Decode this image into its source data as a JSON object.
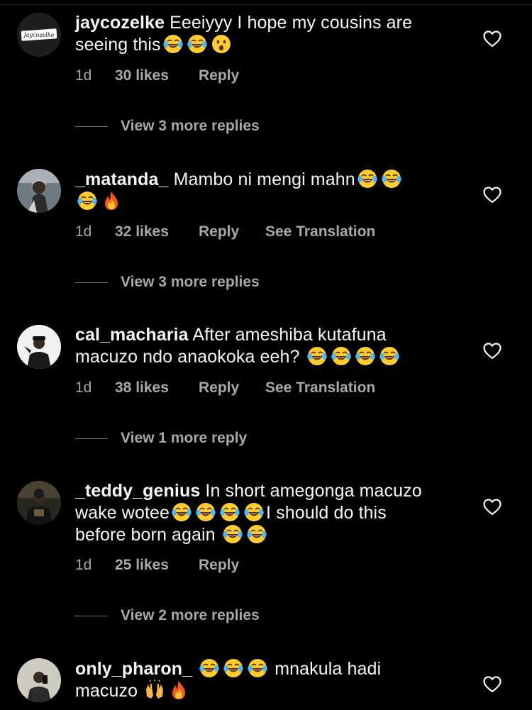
{
  "comments": [
    {
      "username": "jaycozelke",
      "avatar_text": "Jaycozelke",
      "text_line1": "Eeeiyyy I hope my cousins are",
      "text_line2": "seeing this",
      "emojis_line2": [
        "joy-emoji",
        "joy-emoji",
        "astonished-emoji"
      ],
      "time": "1d",
      "likes": "30 likes",
      "reply": "Reply",
      "view_more": "View 3 more replies"
    },
    {
      "username": "_matanda_",
      "text_line1": "Mambo ni mengi mahn",
      "emojis_line1": [
        "joy-emoji",
        "joy-emoji"
      ],
      "emojis_line2": [
        "joy-emoji",
        "fire-emoji"
      ],
      "time": "1d",
      "likes": "32 likes",
      "reply": "Reply",
      "translate": "See Translation",
      "view_more": "View 3 more replies"
    },
    {
      "username": "cal_macharia",
      "text_line1": "After ameshiba kutafuna",
      "text_line2": "macuzo ndo anaokoka eeh?",
      "emojis_line2": [
        "joy-emoji",
        "joy-emoji",
        "joy-emoji",
        "joy-emoji"
      ],
      "time": "1d",
      "likes": "38 likes",
      "reply": "Reply",
      "translate": "See Translation",
      "view_more": "View 1 more reply"
    },
    {
      "username": "_teddy_genius",
      "text_line1": "In short amegonga macuzo",
      "text_line2a": "wake wotee",
      "emojis_line2": [
        "joy-emoji",
        "joy-emoji",
        "joy-emoji",
        "joy-emoji"
      ],
      "text_line2b": "I should do this",
      "text_line3": "before born again",
      "emojis_line3": [
        "joy-emoji",
        "joy-emoji"
      ],
      "time": "1d",
      "likes": "25 likes",
      "reply": "Reply",
      "view_more": "View 2 more replies"
    },
    {
      "username": "only_pharon_",
      "emojis_line1": [
        "joy-emoji",
        "joy-emoji",
        "joy-emoji"
      ],
      "text_line1": "mnakula hadi",
      "text_line2": "macuzo",
      "emojis_line2": [
        "raising-hands-emoji",
        "fire-emoji"
      ]
    }
  ],
  "colors": {
    "background": "#000000",
    "text": "#f5f5f5",
    "secondary": "#a8a8a8"
  }
}
